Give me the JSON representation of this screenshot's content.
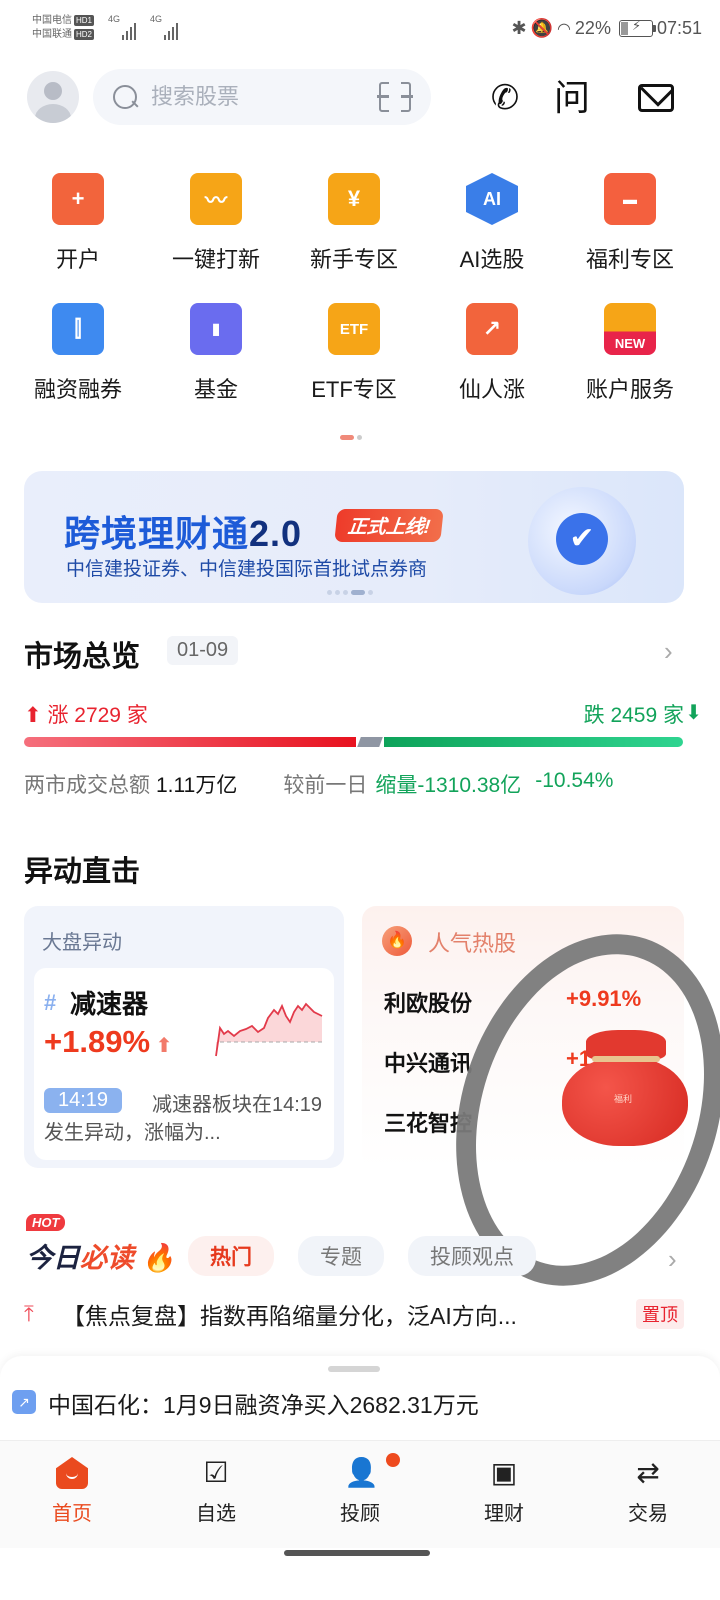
{
  "status_bar": {
    "carrier1": "中国电信",
    "carrier1_badge": "HD1",
    "carrier2": "中国联通",
    "carrier2_badge": "HD2",
    "network1": "4G",
    "network2": "4G",
    "battery": "22%",
    "time": "07:51"
  },
  "topbar": {
    "search_placeholder": "搜索股票",
    "ask_label": "问"
  },
  "grid": [
    {
      "label": "开户",
      "icon": "open-account-icon",
      "glyph": "+",
      "color": "#f2643c"
    },
    {
      "label": "一键打新",
      "icon": "ipo-icon",
      "glyph": "〰",
      "color": "#f6a517"
    },
    {
      "label": "新手专区",
      "icon": "beginner-icon",
      "glyph": "¥",
      "color": "#f6a517"
    },
    {
      "label": "AI选股",
      "icon": "ai-icon",
      "glyph": "AI",
      "color": "#3a7ee8"
    },
    {
      "label": "福利专区",
      "icon": "gift-icon",
      "glyph": "▬",
      "color": "#f4603e"
    },
    {
      "label": "融资融券",
      "icon": "margin-icon",
      "glyph": "⫿",
      "color": "#3e8af0"
    },
    {
      "label": "基金",
      "icon": "fund-icon",
      "glyph": "▮",
      "color": "#6a6cef"
    },
    {
      "label": "ETF专区",
      "icon": "etf-icon",
      "glyph": "ETF",
      "color": "#f6a517"
    },
    {
      "label": "仙人涨",
      "icon": "trend-up-icon",
      "glyph": "↗",
      "color": "#f2643c"
    },
    {
      "label": "账户服务",
      "icon": "account-service-icon",
      "glyph": "NEW",
      "color": "#f6a517"
    }
  ],
  "banner": {
    "title": "跨境理财通",
    "version": "2.0",
    "tag": "正式上线!",
    "subtitle": "中信建投证券、中信建投国际首批试点券商"
  },
  "market": {
    "title": "市场总览",
    "date": "01-09",
    "up_label": "涨 2729 家",
    "down_label": "跌 2459 家",
    "up_count": 2729,
    "down_count": 2459,
    "turnover_label": "两市成交总额",
    "turnover_value": "1.11万亿",
    "compare_label": "较前一日",
    "compare_value": "缩量-1310.38亿",
    "compare_pct": "-10.54%"
  },
  "movers": {
    "title": "异动直击",
    "left": {
      "header": "大盘异动",
      "sector": "减速器",
      "change": "+1.89%",
      "time": "14:19",
      "desc": "减速器板块在14:19发生异动，涨幅为..."
    },
    "right": {
      "header": "人气热股",
      "rows": [
        {
          "name": "利欧股份",
          "change": "+9.91%"
        },
        {
          "name": "中兴通讯",
          "change": "+1"
        },
        {
          "name": "三花智控",
          "change": "+"
        }
      ],
      "bag_label": "福利"
    }
  },
  "news": {
    "hot_badge": "HOT",
    "title_a": "今日",
    "title_b": "必读",
    "tabs": [
      "热门",
      "专题",
      "投顾观点"
    ],
    "items": [
      {
        "text": "【焦点复盘】指数再陷缩量分化，泛AI方向...",
        "tag": "置顶"
      }
    ]
  },
  "ticker": {
    "text": "中国石化：1月9日融资净买入2682.31万元"
  },
  "tabbar": [
    {
      "label": "首页",
      "active": true
    },
    {
      "label": "自选",
      "active": false
    },
    {
      "label": "投顾",
      "active": false
    },
    {
      "label": "理财",
      "active": false
    },
    {
      "label": "交易",
      "active": false
    }
  ]
}
